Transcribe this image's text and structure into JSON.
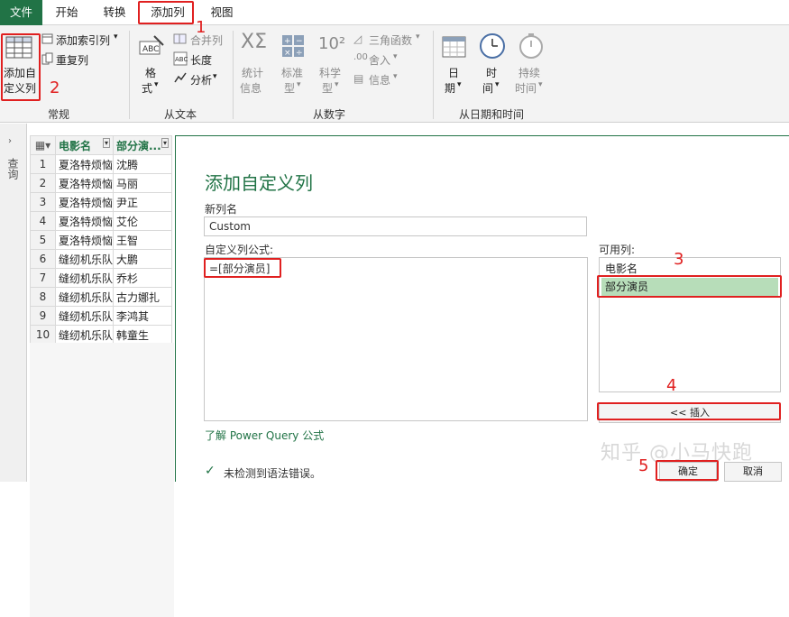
{
  "tabs": [
    {
      "label": "文件"
    },
    {
      "label": "开始"
    },
    {
      "label": "转换"
    },
    {
      "label": "添加列"
    },
    {
      "label": "视图"
    }
  ],
  "ribbon": {
    "groups": {
      "regular": "常规",
      "from_text": "从文本",
      "from_number": "从数字",
      "from_datetime": "从日期和时间"
    },
    "custom_column": {
      "line1": "添加自",
      "line2": "定义列"
    },
    "index_column": "添加索引列",
    "duplicate_column": "重复列",
    "format": {
      "line1": "格",
      "line2": "式"
    },
    "merge_columns": "合并列",
    "length": "长度",
    "analyze": "分析",
    "statistics": {
      "line1": "统计",
      "line2": "信息"
    },
    "standard": {
      "line1": "标准",
      "line2": "型"
    },
    "scientific": {
      "line1": "科学",
      "line2": "型"
    },
    "trig": "三角函数",
    "rounding": "舍入",
    "info": "信息",
    "date": {
      "line1": "日",
      "line2": "期"
    },
    "time": {
      "line1": "时",
      "line2": "间"
    },
    "duration": {
      "line1": "持续",
      "line2": "时间"
    },
    "sci_glyph": "10²",
    "abc_glyph": "ABC"
  },
  "nav": {
    "queries_label": "查询"
  },
  "table": {
    "headers": [
      "电影名",
      "部分演..."
    ],
    "rows": [
      [
        "1",
        "夏洛特烦恼",
        "沈腾"
      ],
      [
        "2",
        "夏洛特烦恼",
        "马丽"
      ],
      [
        "3",
        "夏洛特烦恼",
        "尹正"
      ],
      [
        "4",
        "夏洛特烦恼",
        "艾伦"
      ],
      [
        "5",
        "夏洛特烦恼",
        "王智"
      ],
      [
        "6",
        "缝纫机乐队",
        "大鹏"
      ],
      [
        "7",
        "缝纫机乐队",
        "乔杉"
      ],
      [
        "8",
        "缝纫机乐队",
        "古力娜扎"
      ],
      [
        "9",
        "缝纫机乐队",
        "李鸿其"
      ],
      [
        "10",
        "缝纫机乐队",
        "韩童生"
      ]
    ]
  },
  "dialog": {
    "title": "添加自定义列",
    "new_column_label": "新列名",
    "new_column_value": "Custom",
    "formula_label": "自定义列公式:",
    "formula_value": "=[部分演员]",
    "available_label": "可用列:",
    "available_columns": [
      "电影名",
      "部分演员"
    ],
    "insert_button": "<< 插入",
    "learn_link": "了解 Power Query 公式",
    "status": "未检测到语法错误。",
    "ok_button": "确定",
    "cancel_button": "取消"
  },
  "annotations": {
    "n1": "1",
    "n2": "2",
    "n3": "3",
    "n4": "4",
    "n5": "5"
  },
  "watermark": "知乎 @小马快跑",
  "colors": {
    "accent": "#217346",
    "annotation": "#e02020",
    "selection": "#b7ddb9"
  }
}
